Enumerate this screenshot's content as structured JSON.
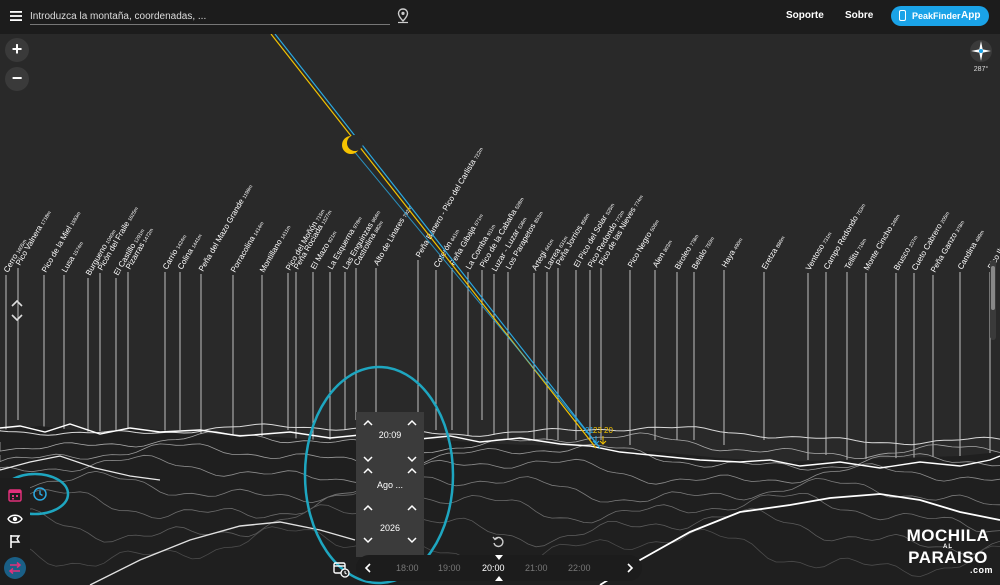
{
  "header": {
    "search_placeholder": "Introduzca la montaña, coordenadas, ...",
    "nav": [
      "Soporte",
      "Sobre"
    ],
    "app_button_brand": "PeakFinder",
    "app_button_suffix": "App"
  },
  "controls": {
    "zoom_in": "+",
    "zoom_out": "−",
    "compass_heading": "287°"
  },
  "peaks": [
    {
      "name": "Cerro",
      "elev": "1605m"
    },
    {
      "name": "Pico Valnera",
      "elev": "1718m"
    },
    {
      "name": "Pico de la Miel",
      "elev": "1593m"
    },
    {
      "name": "Lusa",
      "elev": "1574m"
    },
    {
      "name": "Burgueno",
      "elev": "1040m"
    },
    {
      "name": "Picón del Fraile",
      "elev": "1625m"
    },
    {
      "name": "El Castillo",
      "elev": "1291m"
    },
    {
      "name": "Pizarras",
      "elev": "1472m"
    },
    {
      "name": "Carrio",
      "elev": "1424m"
    },
    {
      "name": "Colina",
      "elev": "1441m"
    },
    {
      "name": "Peña del Mazo Grande",
      "elev": "1199m"
    },
    {
      "name": "Porracolina",
      "elev": "1414m"
    },
    {
      "name": "Montillano",
      "elev": "1411m"
    },
    {
      "name": "Pico del Moñón",
      "elev": "715m"
    },
    {
      "name": "Peña Rociada",
      "elev": "1327m"
    },
    {
      "name": "El Mazo",
      "elev": "921m"
    },
    {
      "name": "La Esquerna",
      "elev": "978m"
    },
    {
      "name": "Las Enguinzas",
      "elev": "964m"
    },
    {
      "name": "Castrolina",
      "elev": "882m"
    },
    {
      "name": "Alto de Linares",
      "elev": "792m"
    },
    {
      "name": "Peña Banero - Pico del Carlista",
      "elev": "722m"
    },
    {
      "name": "Coterón",
      "elev": "641m"
    },
    {
      "name": "Peña Gibaja",
      "elev": "671m"
    },
    {
      "name": "La Comba",
      "elev": "911m"
    },
    {
      "name": "Pico de la Cabaña",
      "elev": "528m"
    },
    {
      "name": "Luzar - Luzar",
      "elev": "536m"
    },
    {
      "name": "Los Parapetos",
      "elev": "853m"
    },
    {
      "name": "Artegi",
      "elev": "641m"
    },
    {
      "name": "Larrea",
      "elev": "631m"
    },
    {
      "name": "Peña Jorrios",
      "elev": "856m"
    },
    {
      "name": "El Pico del Solar",
      "elev": "525m"
    },
    {
      "name": "Pico Redondo",
      "elev": "772m"
    },
    {
      "name": "Pico de las Nieves",
      "elev": "774m"
    },
    {
      "name": "Pico Negro",
      "elev": "506m"
    },
    {
      "name": "Alen",
      "elev": "803m"
    },
    {
      "name": "Biroleo",
      "elev": "778m"
    },
    {
      "name": "Belalo",
      "elev": "750m"
    },
    {
      "name": "Haya",
      "elev": "490m"
    },
    {
      "name": "Eretza",
      "elev": "886m"
    },
    {
      "name": "Ventoso",
      "elev": "731m"
    },
    {
      "name": "Campo Redondo",
      "elev": "753m"
    },
    {
      "name": "Tellitu",
      "elev": "716m"
    },
    {
      "name": "Monte Cincho",
      "elev": "249m"
    },
    {
      "name": "Brusco",
      "elev": "237m"
    },
    {
      "name": "Cueto Cabrero",
      "elev": "205m"
    },
    {
      "name": "Peña Ganzo",
      "elev": "378m"
    },
    {
      "name": "Candina",
      "elev": "489m"
    },
    {
      "name": "Pico Ilso",
      "elev": ""
    }
  ],
  "sun_labels": [
    "21",
    "23",
    "20"
  ],
  "time_picker": {
    "time": "20:09",
    "month": "Ago ...",
    "year": "2026"
  },
  "timeline": {
    "labels": [
      "18:00",
      "19:00",
      "20:00",
      "21:00",
      "22:00"
    ],
    "current": "20:00"
  },
  "watermark": {
    "line1": "MOCHILA",
    "line2": "AL",
    "line3": "PARAISO",
    "line4": ".com"
  },
  "colors": {
    "accent": "#1aa3e8",
    "sun_path": "#f2c200",
    "moon_path": "#2aa8e0",
    "moon": "#f5c200",
    "highlight_ring": "#1ea6c0",
    "calendar_icon": "#e0307a"
  }
}
